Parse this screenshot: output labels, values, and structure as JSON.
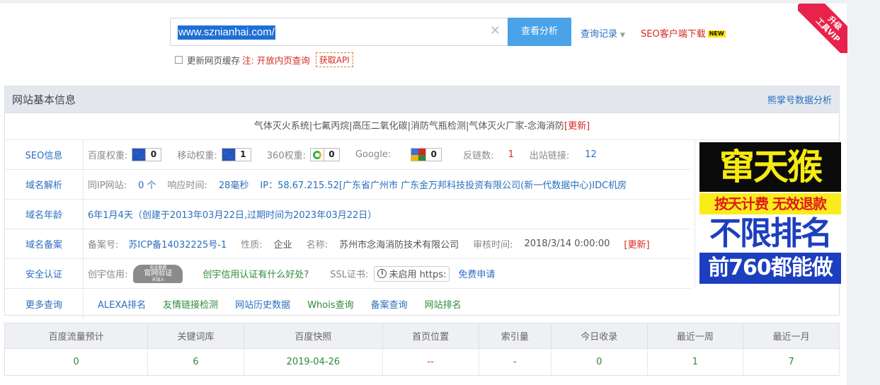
{
  "search": {
    "url": "www.sznianhai.com/",
    "submit_label": "查看分析",
    "history_label": "查询记录",
    "client_label": "SEO客户端下载",
    "new_badge": "NEW"
  },
  "options": {
    "cache_label": "更新网页缓存",
    "note_prefix": "注:",
    "note_link": "开放内页查询",
    "api_label": "获取API"
  },
  "ribbon": {
    "line1": "升级",
    "line2": "工具VIP"
  },
  "panel": {
    "title": "网站基本信息",
    "link": "熊掌号数据分析",
    "site_title": "气体灭火系统|七氟丙烷|高压二氧化碳|消防气瓶检测|气体灭火厂家-念海消防",
    "site_update": "[更新]"
  },
  "seo": {
    "label": "SEO信息",
    "baidu_label": "百度权重:",
    "baidu_value": "0",
    "mobile_label": "移动权重:",
    "mobile_value": "1",
    "so_label": "360权重:",
    "so_value": "0",
    "google_label": "Google:",
    "google_value": "0",
    "backlinks_label": "反链数:",
    "backlinks_value": "1",
    "outlinks_label": "出站链接:",
    "outlinks_value": "12"
  },
  "dns": {
    "label": "域名解析",
    "same_ip_label": "同IP网站:",
    "same_ip_value": "0 个",
    "response_label": "响应时间:",
    "response_value": "28毫秒",
    "ip_text": "IP：58.67.215.52[广东省广州市 广东金万邦科技投资有限公司(新一代数据中心)IDC机房"
  },
  "age": {
    "label": "域名年龄",
    "value": "6年1月4天（创建于2013年03月22日,过期时间为2023年03月22日）"
  },
  "icp": {
    "label": "域名备案",
    "no_label": "备案号:",
    "no_value": "苏ICP备14032225号-1",
    "type_label": "性质:",
    "type_value": "企业",
    "name_label": "名称:",
    "name_value": "苏州市念海消防技术有限公司",
    "audit_label": "审核时间:",
    "audit_value": "2018/3/14 0:00:00",
    "update": "[更新]"
  },
  "security": {
    "label": "安全认证",
    "credit_label": "创宇信用:",
    "badge_top": "安全联盟",
    "badge_main": "官网验证",
    "badge_sub": "未加入",
    "credit_link": "创宇信用认证有什么好处?",
    "ssl_label": "SSL证书:",
    "ssl_value": "未启用 https:",
    "ssl_link": "免费申请"
  },
  "more": {
    "label": "更多查询",
    "links": [
      "ALEXA排名",
      "友情链接检测",
      "网站历史数据",
      "Whois查询",
      "备案查询",
      "网站排名"
    ]
  },
  "ad": {
    "line1": "窜天猴",
    "line2": "按天计费 无效退款",
    "line3": "不限排名",
    "line4": "前760都能做"
  },
  "stats": {
    "headers": [
      "百度流量预计",
      "关键词库",
      "百度快照",
      "首页位置",
      "索引量",
      "今日收录",
      "最近一周",
      "最近一月"
    ],
    "values": [
      "0",
      "6",
      "2019-04-26",
      "--",
      "-",
      "0",
      "1",
      "7"
    ]
  },
  "colors": {
    "accent": "#4aa3e8",
    "link": "#2a6fbf",
    "alert": "#d7281e",
    "ok": "#2f8a3c"
  }
}
